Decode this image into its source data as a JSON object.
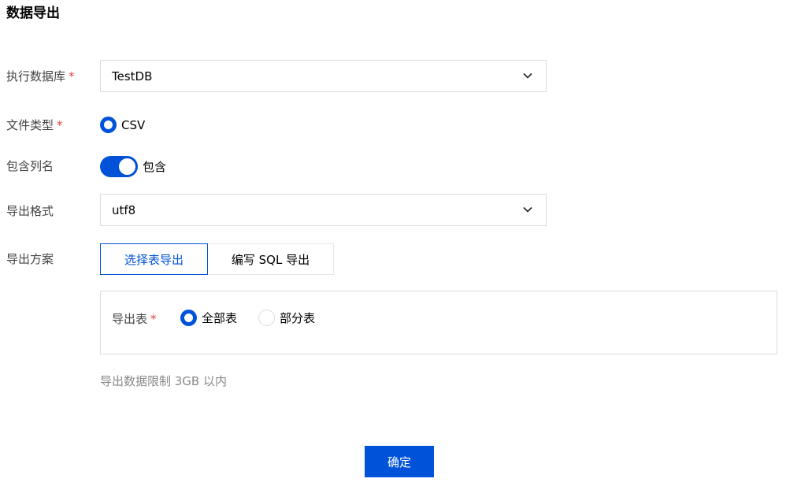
{
  "page": {
    "title": "数据导出"
  },
  "form": {
    "database": {
      "label": "执行数据库",
      "required_mark": "*",
      "value": "TestDB"
    },
    "file_type": {
      "label": "文件类型",
      "required_mark": "*",
      "option": "CSV",
      "selected": true
    },
    "include_columns": {
      "label": "包含列名",
      "toggle_text": "包含",
      "enabled": true
    },
    "export_format": {
      "label": "导出格式",
      "value": "utf8"
    },
    "export_plan": {
      "label": "导出方案",
      "options": [
        "选择表导出",
        "编写 SQL 导出"
      ],
      "active_index": 0
    },
    "export_table": {
      "label": "导出表",
      "required_mark": "*",
      "options": [
        {
          "label": "全部表",
          "selected": true
        },
        {
          "label": "部分表",
          "selected": false
        }
      ]
    },
    "limit_hint": "导出数据限制 3GB 以内"
  },
  "actions": {
    "confirm_label": "确定"
  },
  "colors": {
    "primary": "#0052d9",
    "required": "#e54545",
    "border": "#dcdcdc"
  }
}
